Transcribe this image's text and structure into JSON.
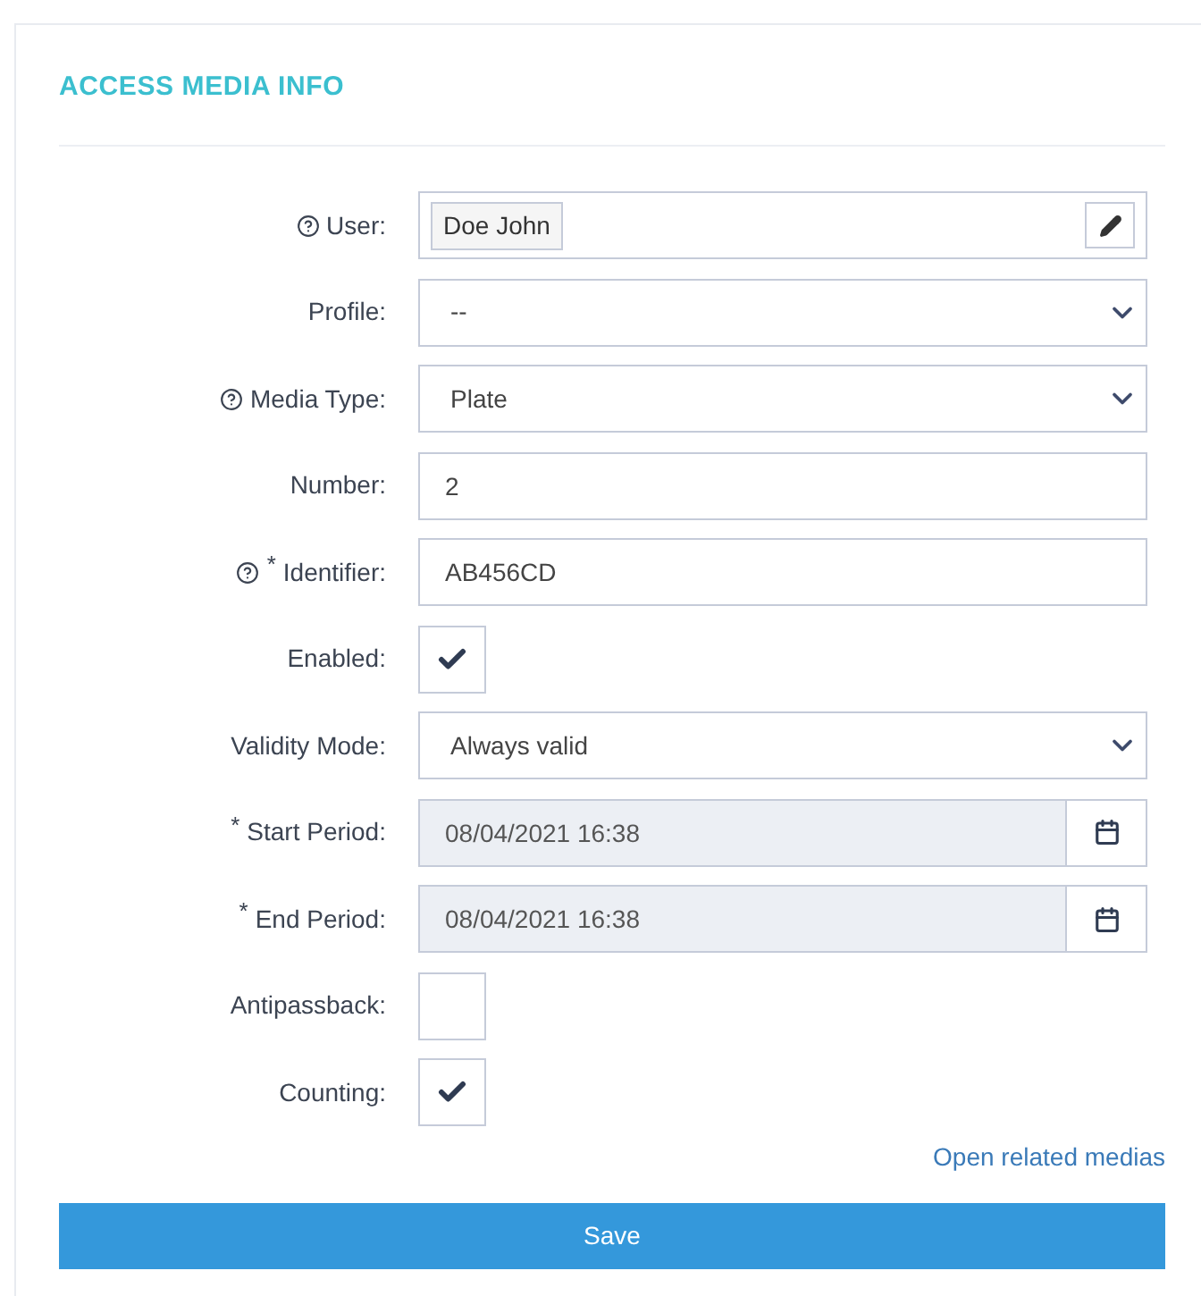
{
  "title": "ACCESS MEDIA INFO",
  "fields": [
    {
      "label": "User:",
      "help": true,
      "kind": "chip",
      "value": "Doe John"
    },
    {
      "label": "Profile:",
      "help": false,
      "kind": "select",
      "value": "--"
    },
    {
      "label": "Media Type:",
      "help": true,
      "kind": "select",
      "value": "Plate"
    },
    {
      "label": "Number:",
      "help": false,
      "kind": "text",
      "value": "2"
    },
    {
      "label": "Identifier:",
      "help": true,
      "required_mark": "*",
      "kind": "text",
      "value": "AB456CD"
    },
    {
      "label": "Enabled:",
      "help": false,
      "kind": "checkbox",
      "checked": true
    },
    {
      "label": "Validity Mode:",
      "help": false,
      "kind": "select",
      "value": "Always valid"
    },
    {
      "label": "Start Period:",
      "help": false,
      "required_mark": "*",
      "kind": "date",
      "value": "08/04/2021 16:38"
    },
    {
      "label": "End Period:",
      "help": false,
      "required_mark": "*",
      "kind": "date",
      "value": "08/04/2021 16:38"
    },
    {
      "label": "Antipassback:",
      "help": false,
      "kind": "checkbox",
      "checked": false
    },
    {
      "label": "Counting:",
      "help": false,
      "kind": "checkbox",
      "checked": true
    }
  ],
  "link": "Open related medias",
  "save_button": "Save"
}
